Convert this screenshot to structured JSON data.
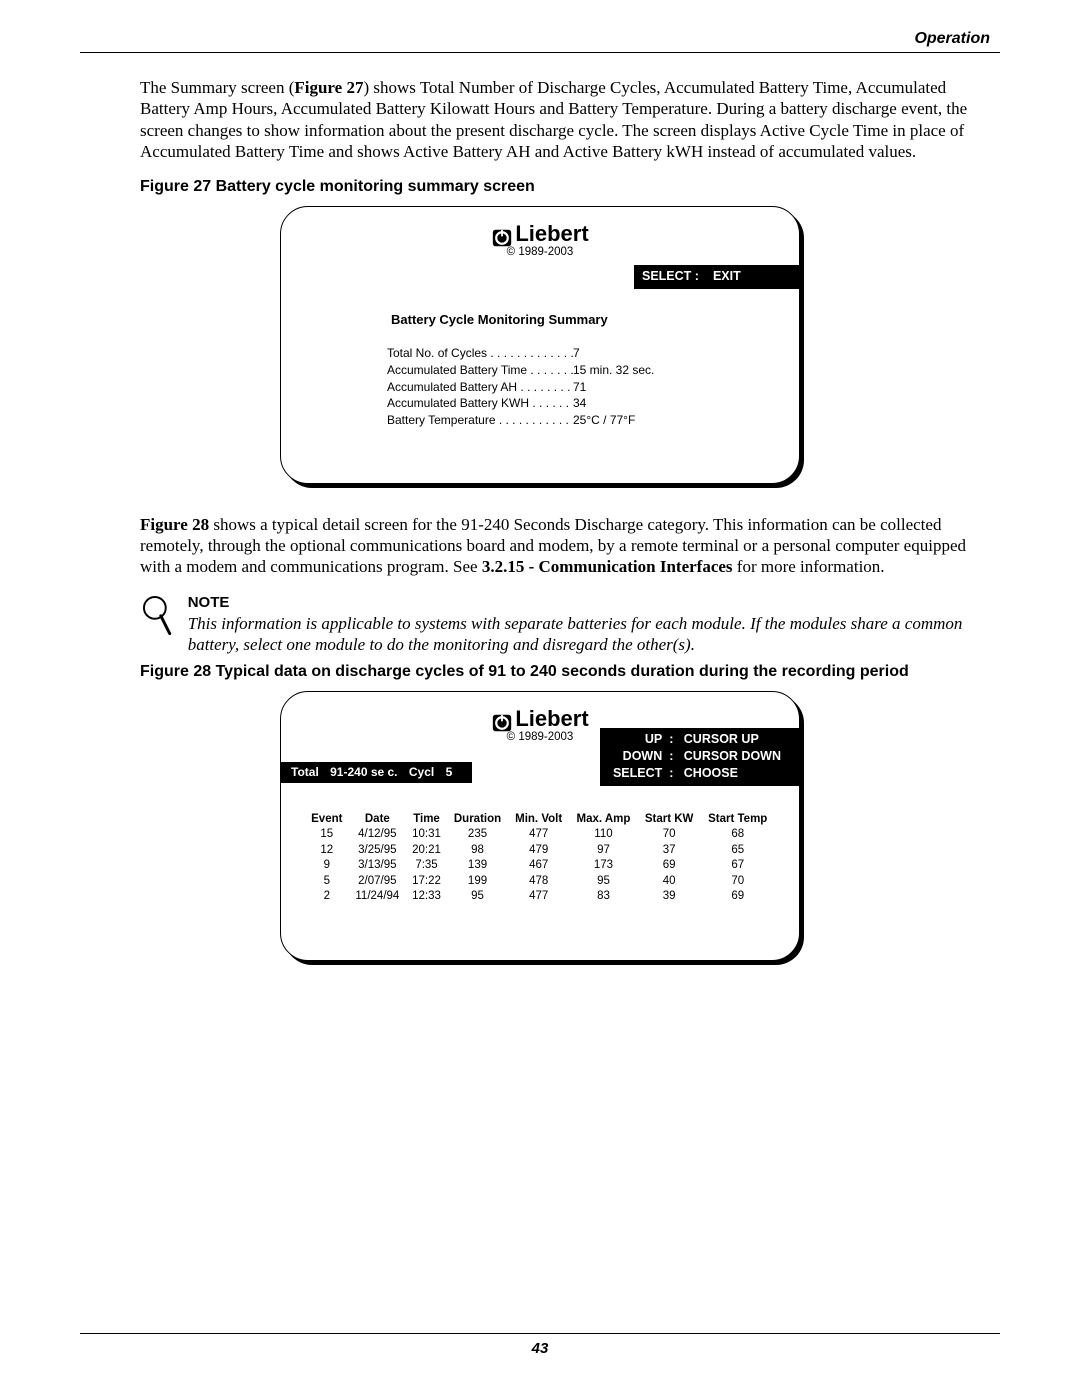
{
  "header": {
    "section": "Operation",
    "page_number": "43"
  },
  "para1_a": "The Summary screen (",
  "para1_ref1": "Figure 27",
  "para1_b": ") shows Total Number of Discharge Cycles, Accumulated Battery Time, Accumulated Battery Amp Hours, Accumulated Battery Kilowatt Hours and Battery Temperature. During a battery discharge event, the screen changes to show information about the present discharge cycle. The screen displays Active Cycle Time in place of Accumulated Battery Time and shows Active Battery AH and Active Battery kWH instead of accumulated values.",
  "caption27": "Figure 27  Battery cycle monitoring summary screen",
  "brand": {
    "name": "Liebert",
    "copyright": "© 1989-2003"
  },
  "screen27": {
    "menu": {
      "select_label": "SELECT :",
      "select_action": "EXIT"
    },
    "title": "Battery Cycle Monitoring Summary",
    "rows": [
      {
        "label": "Total No. of Cycles . . . . . . . . . . . . .",
        "value": "7"
      },
      {
        "label": "Accumulated Battery Time . . . . . . .",
        "value": "15 min. 32 sec."
      },
      {
        "label": "Accumulated Battery AH  . . . . . . . .",
        "value": "71"
      },
      {
        "label": "Accumulated Battery KWH . . . . . . .",
        "value": "34"
      },
      {
        "label": "Battery Temperature . . . . . . . . . . . .",
        "value": "25°C / 77°F"
      }
    ]
  },
  "para2_a_ref": "Figure 28",
  "para2_b": " shows a typical detail screen for the 91-240 Seconds Discharge category. This information can be collected remotely, through the optional communications board and modem, by a remote terminal or a personal computer equipped with a modem and communications program. See ",
  "para2_ref2": "3.2.15 - Communication Interfaces",
  "para2_c": " for more information.",
  "note": {
    "head": "NOTE",
    "body": "This information is applicable to systems with separate batteries for each module. If the modules share a common battery, select one module to do the monitoring and disregard the other(s)."
  },
  "caption28": "Figure 28  Typical data on discharge cycles of 91 to 240 seconds duration during the recording period",
  "screen28": {
    "menu": {
      "up_label": "UP",
      "up_action": "CURSOR UP",
      "down_label": "DOWN",
      "down_action": "CURSOR DOWN",
      "select_label": "SELECT",
      "select_action": "CHOOSE"
    },
    "status": {
      "total_label": "Total",
      "range": "91-240 se c.",
      "cycl_label": "Cycl",
      "count": "5"
    },
    "headers": [
      "Event",
      "Date",
      "Time",
      "Duration",
      "Min. Volt",
      "Max. Amp",
      "Start KW",
      "Start Temp"
    ],
    "rows": [
      [
        "15",
        "4/12/95",
        "10:31",
        "235",
        "477",
        "110",
        "70",
        "68"
      ],
      [
        "12",
        "3/25/95",
        "20:21",
        "98",
        "479",
        "97",
        "37",
        "65"
      ],
      [
        "9",
        "3/13/95",
        "7:35",
        "139",
        "467",
        "173",
        "69",
        "67"
      ],
      [
        "5",
        "2/07/95",
        "17:22",
        "199",
        "478",
        "95",
        "40",
        "70"
      ],
      [
        "2",
        "11/24/94",
        "12:33",
        "95",
        "477",
        "83",
        "39",
        "69"
      ]
    ]
  }
}
